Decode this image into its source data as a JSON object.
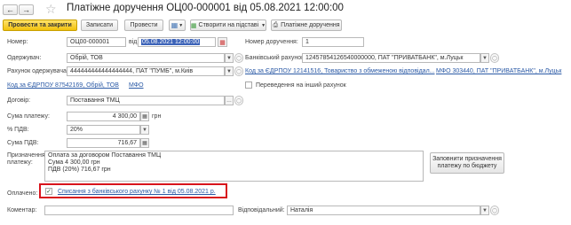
{
  "header": {
    "title": "Платіжне доручення ОЦ00-000001 від 05.08.2021 12:00:00"
  },
  "toolbar": {
    "post_close": "Провести та закрити",
    "save": "Записати",
    "post": "Провести",
    "create_based": "Створити на підставі",
    "payment_order": "Платіжне доручення"
  },
  "form": {
    "number_label": "Номер:",
    "number_value": "ОЦ00-000001",
    "from_label": "від:",
    "date_value": "05.08.2021 12:00:00",
    "order_number_label": "Номер доручення:",
    "order_number_value": "1",
    "recipient_label": "Одержувач:",
    "recipient_value": "Обрій, ТОВ",
    "bank_account_label": "Банківський рахунок:",
    "bank_account_value": "12457854126540000000, ПАТ \"ПРИВАТБАНК\", м.Луцьк",
    "recipient_account_label": "Рахунок одержувача:",
    "recipient_account_value": "444444444444444444, ПАТ \"ПУМБ\", м.Киів",
    "edrpou_right_link": "Код за ЄДРПОУ 12141516, Товариство з обмеженою відповідал...",
    "bank_right_link": "МФО 303440, ПАТ \"ПРИВАТБАНК\", м.Луцьк",
    "edrpou_left_link": "Код за ЄДРПОУ 87542169, Обрій, ТОВ",
    "mfo_left_link": "МФО",
    "transfer_label": "Переведення на інший рахунок",
    "contract_label": "Договір:",
    "contract_value": "Поставання ТМЦ",
    "amount_label": "Сума платежу:",
    "amount_value": "4 300,00",
    "currency": "грн",
    "vat_rate_label": "% ПДВ:",
    "vat_rate_value": "20%",
    "vat_amount_label": "Сума ПДВ:",
    "vat_amount_value": "716,67",
    "purpose_label_1": "Призначення",
    "purpose_label_2": "платежу:",
    "purpose_line1": "Оплата за договором Поставання ТМЦ",
    "purpose_line2": "Сума 4 300,00 грн",
    "purpose_line3": "ПДВ (20%) 716,67 грн",
    "fill_purpose_btn_1": "Заповнити призначення",
    "fill_purpose_btn_2": "платежу по бюджету",
    "paid_label": "Оплачено:",
    "paid_link": "Списання з банківського рахунку № 1 від 05.08.2021 р.",
    "comment_label": "Коментар:",
    "responsible_label": "Відповідальний:",
    "responsible_value": "Наталія"
  },
  "colors": {
    "primary_button": "#f2c10c",
    "link": "#2b5aa6",
    "highlight_frame": "#d8141c"
  }
}
